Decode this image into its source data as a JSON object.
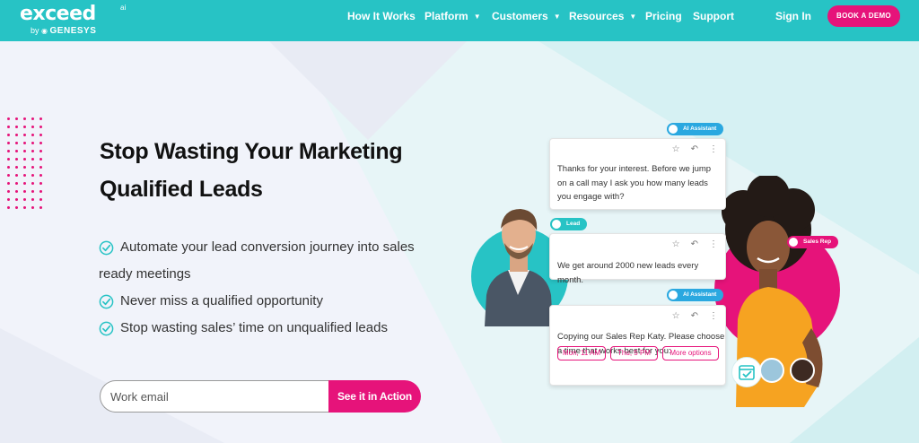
{
  "brand": {
    "logo_word": "exceed",
    "logo_ai": "ai",
    "logo_by": "by",
    "logo_company": "GENESYS"
  },
  "nav": {
    "items": [
      {
        "label": "How It Works",
        "has_caret": false
      },
      {
        "label": "Platform",
        "has_caret": true
      },
      {
        "label": "Customers",
        "has_caret": true
      },
      {
        "label": "Resources",
        "has_caret": true
      },
      {
        "label": "Pricing",
        "has_caret": false
      },
      {
        "label": "Support",
        "has_caret": false
      }
    ],
    "signin": "Sign In",
    "cta": "BOOK A DEMO"
  },
  "hero": {
    "headline_line1": "Stop Wasting Your Marketing",
    "headline_line2": "Qualified Leads",
    "bullets": [
      {
        "text": "Automate your lead conversion journey into sales"
      },
      {
        "text": "ready meetings",
        "continuation": true
      },
      {
        "text": "Never miss a qualified opportunity"
      },
      {
        "text": "Stop wasting sales’ time on unqualified leads"
      }
    ],
    "email_placeholder": "Work email",
    "cta_button": "See it in Action"
  },
  "chat": {
    "badge_ai_1": "AI Assistant",
    "msg_ai_1": [
      "Thanks for your interest. Before we jump",
      "on a call may I ask you how many leads",
      "you engage with?"
    ],
    "badge_lead": "Lead",
    "msg_lead": "We get around 2000 new leads every month.",
    "badge_ai_2": "AI Assistant",
    "msg_ai_2": [
      "Copying our Sales Rep Katy. Please choose",
      "a time that works best for you:"
    ],
    "chips": [
      "Mon, 11 AM",
      "Thu, 5 PM",
      "More options"
    ],
    "badge_rep": "Sales Rep"
  },
  "icons": {
    "card_actions": [
      "star-icon",
      "reply-icon",
      "more-vertical-icon"
    ],
    "bullet": "check-circle-icon",
    "calendar": "calendar-check-icon"
  },
  "colors": {
    "header_bg": "#27c3c5",
    "accent_pink": "#e6137a",
    "accent_blue": "#2aa8e0",
    "check_teal": "#27c3c5"
  }
}
